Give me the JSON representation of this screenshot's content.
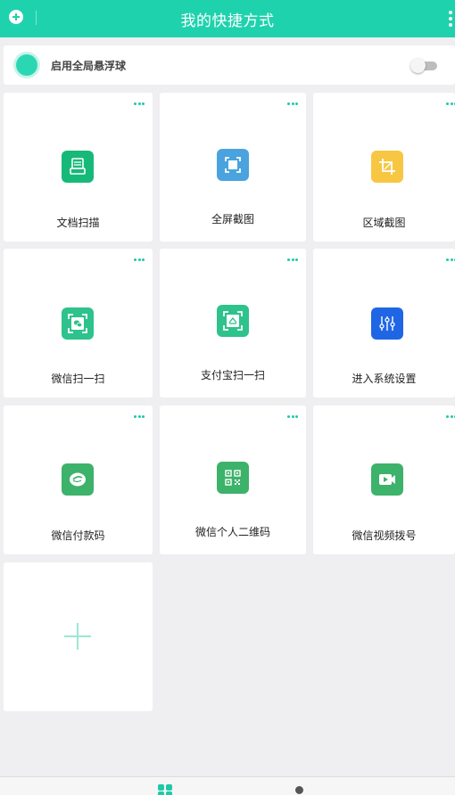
{
  "header": {
    "title": "我的快捷方式"
  },
  "float_ball": {
    "label": "启用全局悬浮球",
    "enabled": false
  },
  "shortcuts": [
    {
      "label": "文档扫描",
      "icon": "document-scan-icon",
      "color": "#17b978"
    },
    {
      "label": "全屏截图",
      "icon": "fullscreen-screenshot-icon",
      "color": "#4aa3df"
    },
    {
      "label": "区域截图",
      "icon": "crop-icon",
      "color": "#f7c744"
    },
    {
      "label": "微信扫一扫",
      "icon": "wechat-scan-icon",
      "color": "#2ec28c"
    },
    {
      "label": "支付宝扫一扫",
      "icon": "alipay-scan-icon",
      "color": "#2ec28c"
    },
    {
      "label": "进入系统设置",
      "icon": "settings-sliders-icon",
      "color": "#1f66e5"
    },
    {
      "label": "微信付款码",
      "icon": "wechat-pay-icon",
      "color": "#3db26a"
    },
    {
      "label": "微信个人二维码",
      "icon": "qr-code-icon",
      "color": "#3db26a"
    },
    {
      "label": "微信视频拨号",
      "icon": "video-call-icon",
      "color": "#3db26a"
    }
  ],
  "colors": {
    "accent": "#1fd2ae",
    "background": "#efeff1"
  },
  "bottom_nav": [
    "shortcuts-tab-icon",
    "me-tab-icon"
  ]
}
